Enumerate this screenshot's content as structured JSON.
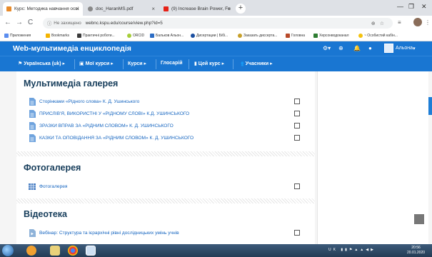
{
  "browser": {
    "tabs": [
      {
        "label": "Курс: Методика навчання осві",
        "active": true
      },
      {
        "label": "doc_HaranMS.pdf",
        "active": false
      },
      {
        "label": "(9) Increase Brain Power, Fo",
        "active": false
      }
    ],
    "new_tab": "+",
    "address": {
      "security": "Не захищено",
      "url": "webnc.kspu.edu/course/view.php?id=5"
    },
    "bookmarks": [
      "Приложения",
      "Bookmarks",
      "Практичні роботи...",
      "ORCID",
      "Бальков Альон...",
      "Дисертации | Бібі...",
      "Заказать диссерта...",
      "Головна",
      "Херсонводоканал",
      "~ Особистий кабін..."
    ]
  },
  "site": {
    "title": "Web-мультимедіа енциклопедія",
    "user_name": "Альона"
  },
  "menu": [
    "Українська (uk)",
    "Мої курси",
    "Курси",
    "Глосарій",
    "Цей курс",
    "Учасники"
  ],
  "sections": [
    {
      "title": "Мультимедіа галерея",
      "items": [
        "Сторінками «Рідного слова» К. Д. Ушинського",
        "ПРИСЛІВ'Я, ВИКОРИСТНІ У «РІДНОМУ СЛОВІ» К.Д. УШИНСЬКОГО",
        "ЗРАЗКИ ВПРАВ ЗА «РІДНИМ СЛОВОМ» К. Д. УШИНСЬКОГО",
        "КАЗКИ ТА ОПОВІДАННЯ ЗА «РІДНИМ СЛОВОМ» К. Д. УШИНСЬКОГО"
      ]
    },
    {
      "title": "Фотогалерея",
      "items": [
        "Фотогалерея"
      ]
    },
    {
      "title": "Відеотека",
      "items": [
        "Вебінар: Структура та ієрархічні рівні дослідницьких умінь учнів"
      ]
    }
  ],
  "taskbar": {
    "lang": "UK",
    "time": "20:56",
    "date": "20.01.2020"
  },
  "colors": {
    "brand": "#1976d2",
    "link": "#1565c0",
    "section_title": "#153c5a"
  }
}
